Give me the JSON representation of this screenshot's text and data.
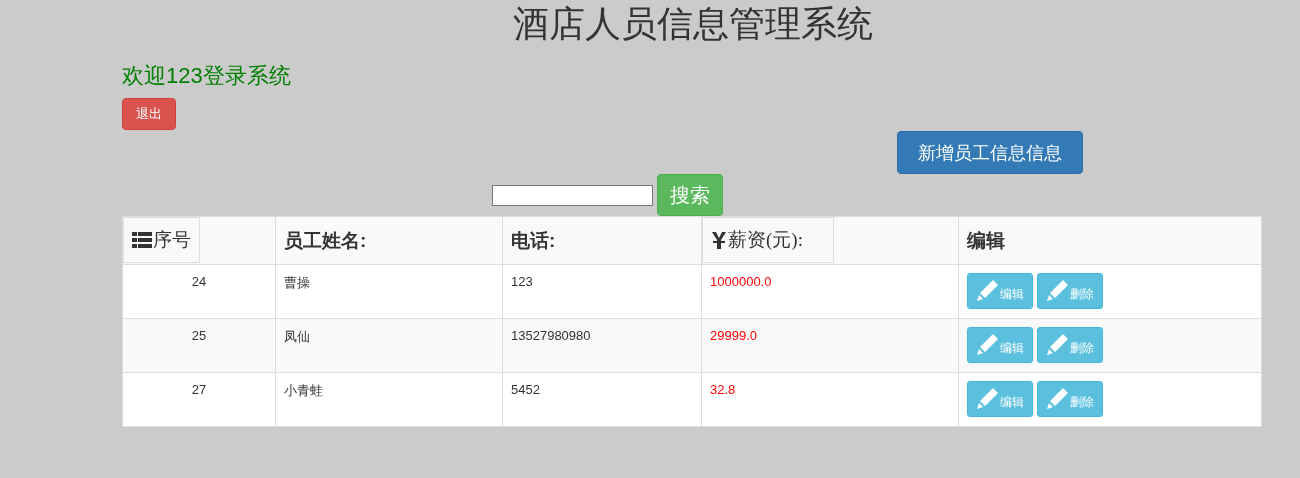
{
  "title": "酒店人员信息管理系统",
  "welcome": "欢迎123登录系统",
  "logout_button": "退出",
  "add_button": "新增员工信息信息",
  "search": {
    "button": "搜索"
  },
  "table": {
    "columns": [
      {
        "label": "序号",
        "kind": "button"
      },
      {
        "label": "员工姓名:",
        "kind": "text"
      },
      {
        "label": "电话:",
        "kind": "text"
      },
      {
        "label": "薪资(元):",
        "kind": "button"
      },
      {
        "label": "编辑",
        "kind": "text"
      }
    ],
    "rows": [
      {
        "id": "24",
        "name": "曹操",
        "phone": "123",
        "salary": "1000000.0",
        "actions": [
          "编辑",
          "删除"
        ]
      },
      {
        "id": "25",
        "name": "凤仙",
        "phone": "13527980980",
        "salary": "29999.0",
        "actions": [
          "编辑",
          "删除"
        ]
      },
      {
        "id": "27",
        "name": "小青蛙",
        "phone": "5452",
        "salary": "32.8",
        "actions": [
          "编辑",
          "删除"
        ]
      }
    ]
  }
}
